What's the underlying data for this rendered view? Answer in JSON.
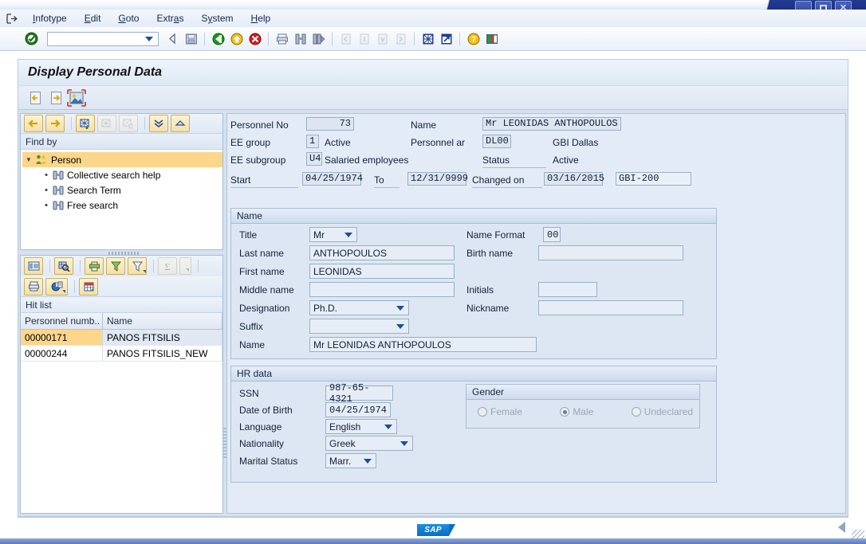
{
  "window": {
    "minimize_label": "minimize",
    "maximize_label": "maximize",
    "close_label": "✕"
  },
  "menubar": {
    "items": [
      {
        "label": "Infotype",
        "accel": "I"
      },
      {
        "label": "Edit",
        "accel": "E"
      },
      {
        "label": "Goto",
        "accel": "G"
      },
      {
        "label": "Extras",
        "accel": "a"
      },
      {
        "label": "System",
        "accel": "y"
      },
      {
        "label": "Help",
        "accel": "H"
      }
    ]
  },
  "toolbar": {
    "command_field_value": "",
    "command_field_placeholder": "",
    "icons": [
      "enter-check-icon",
      "back-arrow-icon",
      "save-icon",
      "exit-green-icon",
      "back-yellow-icon",
      "cancel-red-icon",
      "print-icon",
      "find-icon",
      "find-next-icon",
      "first-page-icon",
      "previous-page-icon",
      "next-page-icon",
      "last-page-icon",
      "new-session-icon",
      "create-shortcut-icon",
      "help-icon",
      "customize-layout-icon"
    ]
  },
  "page": {
    "title": "Display Personal Data",
    "subtoolbar_icons": [
      "previous-record-icon",
      "next-record-icon",
      "photo-icon"
    ]
  },
  "find_panel": {
    "toolbar_icons": [
      "back-icon",
      "forward-icon",
      "add-search-icon",
      "delete-search-icon",
      "remove-search-icon",
      "expand-all-icon",
      "collapse-all-icon"
    ],
    "header": "Find by",
    "tree": {
      "root": "Person",
      "children": [
        "Collective search help",
        "Search Term",
        "Free search"
      ]
    }
  },
  "hit_list": {
    "toolbar_icons_row1": [
      "detail-list-icon",
      "search-grid-icon",
      "print-grid-icon",
      "sort-filter-icon",
      "filter-icon",
      "sum-icon"
    ],
    "toolbar_icons_row2": [
      "print-preview-icon",
      "chart-icon",
      "spreadsheet-icon"
    ],
    "header": "Hit list",
    "columns": [
      "Personnel numb..",
      "Name"
    ],
    "rows": [
      {
        "personnel_number": "00000171",
        "name": "PANOS FITSILIS",
        "selected": true
      },
      {
        "personnel_number": "00000244",
        "name": "PANOS FITSILIS_NEW",
        "selected": false
      }
    ]
  },
  "header_fields": {
    "personnel_no_label": "Personnel No",
    "personnel_no_value": "73",
    "name_label": "Name",
    "name_value": "Mr LEONIDAS ANTHOPOULOS",
    "ee_group_label": "EE group",
    "ee_group_value": "1",
    "ee_group_text": "Active",
    "personnel_area_label": "Personnel ar",
    "personnel_area_value": "DL00",
    "personnel_area_text": "GBI Dallas",
    "ee_subgroup_label": "EE subgroup",
    "ee_subgroup_value": "U4",
    "ee_subgroup_text": "Salaried employees",
    "status_label": "Status",
    "status_text": "Active",
    "start_label": "Start",
    "start_value": "04/25/1974",
    "to_label": "To",
    "to_value": "12/31/9999",
    "changed_on_label": "Changed on",
    "changed_on_value": "03/16/2015",
    "client_value": "GBI-200"
  },
  "name_group": {
    "title": "Name",
    "title_label": "Title",
    "title_value": "Mr",
    "name_format_label": "Name Format",
    "name_format_value": "00",
    "last_name_label": "Last name",
    "last_name_value": "ANTHOPOULOS",
    "birth_name_label": "Birth name",
    "birth_name_value": "",
    "first_name_label": "First name",
    "first_name_value": "LEONIDAS",
    "middle_name_label": "Middle name",
    "middle_name_value": "",
    "initials_label": "Initials",
    "initials_value": "",
    "designation_label": "Designation",
    "designation_value": "Ph.D.",
    "nickname_label": "Nickname",
    "nickname_value": "",
    "suffix_label": "Suffix",
    "suffix_value": "",
    "full_name_label": "Name",
    "full_name_value": "Mr LEONIDAS ANTHOPOULOS"
  },
  "hr_data_group": {
    "title": "HR data",
    "ssn_label": "SSN",
    "ssn_value": "987-65-4321",
    "dob_label": "Date of Birth",
    "dob_value": "04/25/1974",
    "language_label": "Language",
    "language_value": "English",
    "nationality_label": "Nationality",
    "nationality_value": "Greek",
    "marital_status_label": "Marital Status",
    "marital_status_value": "Marr.",
    "gender": {
      "title": "Gender",
      "options": [
        {
          "label": "Female",
          "selected": false
        },
        {
          "label": "Male",
          "selected": true
        },
        {
          "label": "Undeclared",
          "selected": false
        }
      ]
    }
  },
  "statusbar": {
    "logo": "SAP"
  }
}
